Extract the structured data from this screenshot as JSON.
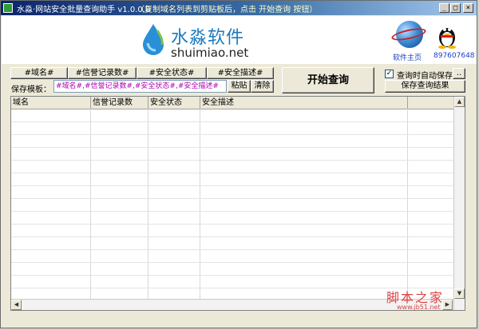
{
  "window": {
    "title": "水淼·网站安全批量查询助手 v1.0.0.0",
    "hint": "（复制域名列表到剪贴板后，点击 开始查询 按钮）",
    "minimize_glyph": "_",
    "maximize_glyph": "□",
    "close_glyph": "×"
  },
  "banner": {
    "logo_cn": "水淼软件",
    "logo_en": "shuimiao.net",
    "home_label": "软件主页",
    "qq_number": "897607648"
  },
  "toolbar": {
    "fields": [
      "#域名#",
      "#信誉记录数#",
      "#安全状态#",
      "#安全描述#"
    ],
    "start_label": "开始查询",
    "template_label": "保存模板：",
    "template_value": "#域名#,#信誉记录数#,#安全状态#,#安全描述#",
    "paste_label": "粘贴",
    "clear_label": "清除",
    "autosave_label": "查询时自动保存",
    "autosave_checked": true,
    "browse_label": "..",
    "save_results_label": "保存查询结果"
  },
  "table": {
    "columns": [
      "域名",
      "信誉记录数",
      "安全状态",
      "安全描述"
    ]
  },
  "watermark": {
    "cn": "脚本之家",
    "url": "www.jb51.net"
  }
}
